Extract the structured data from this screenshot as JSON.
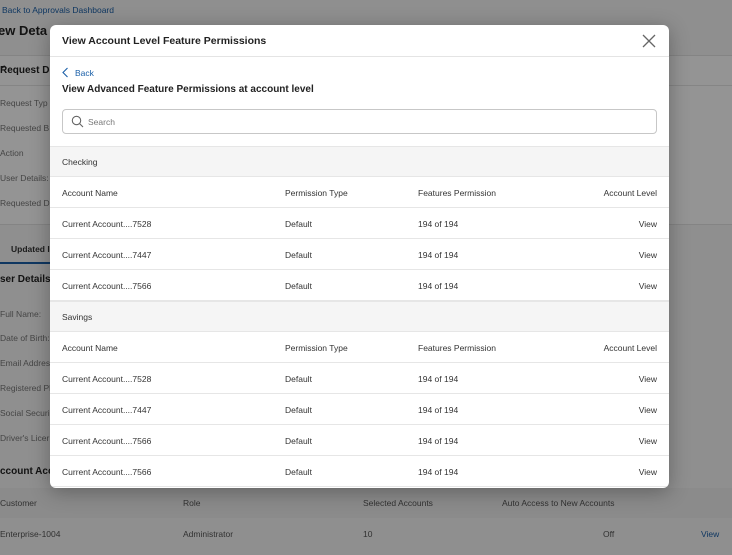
{
  "background": {
    "back_link": "Back to Approvals Dashboard",
    "page_title": "ew Deta",
    "request_card_title": "Request De",
    "request_fields": [
      "Request Typ",
      "Requested B",
      "Action",
      "User Details:",
      "Requested Da"
    ],
    "tab_label": "Updated I",
    "user_details_title": "ser Details",
    "user_fields": [
      "Full Name:",
      "Date of Birth:",
      "Email Addres",
      "Registered Ph",
      "Social Securi",
      "Driver's Licer"
    ],
    "account_access_title": "ccount Acc",
    "table_headers": [
      "Customer",
      "Role",
      "Selected Accounts",
      "Auto Access to New Accounts"
    ],
    "table_row": [
      "Enterprise-1004",
      "Administrator",
      "10",
      "Off",
      "View"
    ]
  },
  "modal": {
    "title": "View Account Level Feature Permissions",
    "back_label": "Back",
    "subtitle": "View Advanced Feature Permissions at account level",
    "search_placeholder": "Search",
    "columns": [
      "Account Name",
      "Permission Type",
      "Features Permission",
      "Account Level"
    ],
    "sections": [
      {
        "name": "Checking",
        "rows": [
          {
            "account": "Current Account....7528",
            "type": "Default",
            "features": "194 of 194",
            "action": "View"
          },
          {
            "account": "Current Account....7447",
            "type": "Default",
            "features": "194 of 194",
            "action": "View"
          },
          {
            "account": "Current Account....7566",
            "type": "Default",
            "features": "194 of 194",
            "action": "View"
          }
        ]
      },
      {
        "name": "Savings",
        "rows": [
          {
            "account": "Current Account....7528",
            "type": "Default",
            "features": "194 of 194",
            "action": "View"
          },
          {
            "account": "Current Account....7447",
            "type": "Default",
            "features": "194 of 194",
            "action": "View"
          },
          {
            "account": "Current Account....7566",
            "type": "Default",
            "features": "194 of 194",
            "action": "View"
          },
          {
            "account": "Current Account....7566",
            "type": "Default",
            "features": "194 of 194",
            "action": "View"
          }
        ]
      }
    ]
  },
  "colors": {
    "accent": "#1a5fa8",
    "overlay": "rgba(0,0,0,0.42)"
  },
  "icons": [
    "close-icon",
    "chevron-left-icon",
    "search-icon",
    "chevron-up-icon"
  ]
}
